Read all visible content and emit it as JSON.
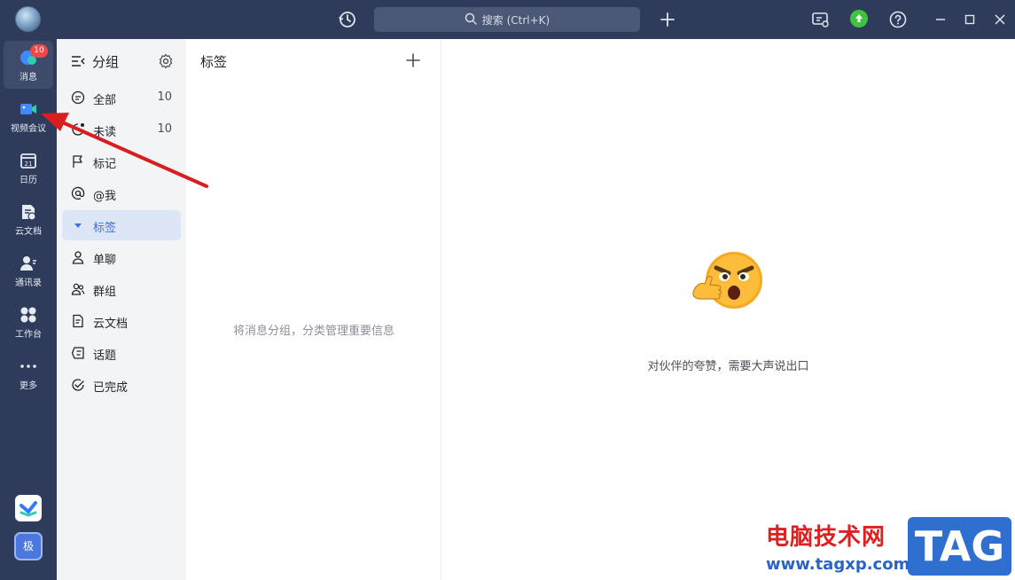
{
  "titlebar": {
    "search_label": "搜索 (Ctrl+K)",
    "icons": [
      "avatar",
      "history-icon",
      "search-icon",
      "plus-icon",
      "screen-notify-icon",
      "upgrade-icon",
      "help-icon",
      "minimize-icon",
      "maximize-icon",
      "close-icon"
    ]
  },
  "rail": {
    "items": [
      {
        "label": "消息",
        "icon": "message-icon",
        "badge": "10"
      },
      {
        "label": "视频会议",
        "icon": "video-meeting-icon"
      },
      {
        "label": "日历",
        "icon": "calendar-icon",
        "day": "21"
      },
      {
        "label": "云文档",
        "icon": "cloud-doc-icon"
      },
      {
        "label": "通讯录",
        "icon": "contacts-icon"
      },
      {
        "label": "工作台",
        "icon": "workbench-icon"
      },
      {
        "label": "更多",
        "icon": "more-icon"
      }
    ],
    "bottom_app_label": "极"
  },
  "groups": {
    "title": "分组",
    "items": [
      {
        "label": "全部",
        "count": "10",
        "icon": "chat-bubble-icon"
      },
      {
        "label": "未读",
        "count": "10",
        "icon": "unread-icon"
      },
      {
        "label": "标记",
        "count": "",
        "icon": "flag-icon"
      },
      {
        "label": "@我",
        "count": "",
        "icon": "at-icon"
      },
      {
        "label": "标签",
        "count": "",
        "icon": "caret-down-icon"
      },
      {
        "label": "单聊",
        "count": "",
        "icon": "person-icon"
      },
      {
        "label": "群组",
        "count": "",
        "icon": "group-icon"
      },
      {
        "label": "云文档",
        "count": "",
        "icon": "doc-icon"
      },
      {
        "label": "话题",
        "count": "",
        "icon": "topic-icon"
      },
      {
        "label": "已完成",
        "count": "",
        "icon": "check-circle-icon"
      }
    ]
  },
  "tags": {
    "title": "标签",
    "empty_text": "将消息分组，分类管理重要信息"
  },
  "right": {
    "text": "对伙伴的夸赞，需要大声说出口"
  },
  "watermark": {
    "text": "电脑技术网",
    "url": "www.tagxp.com",
    "tag": "TAG"
  },
  "colors": {
    "sidebar": "#2e3b5a",
    "accent": "#3f6fd8",
    "badge": "#f04848",
    "arrow": "#d81e1e"
  }
}
